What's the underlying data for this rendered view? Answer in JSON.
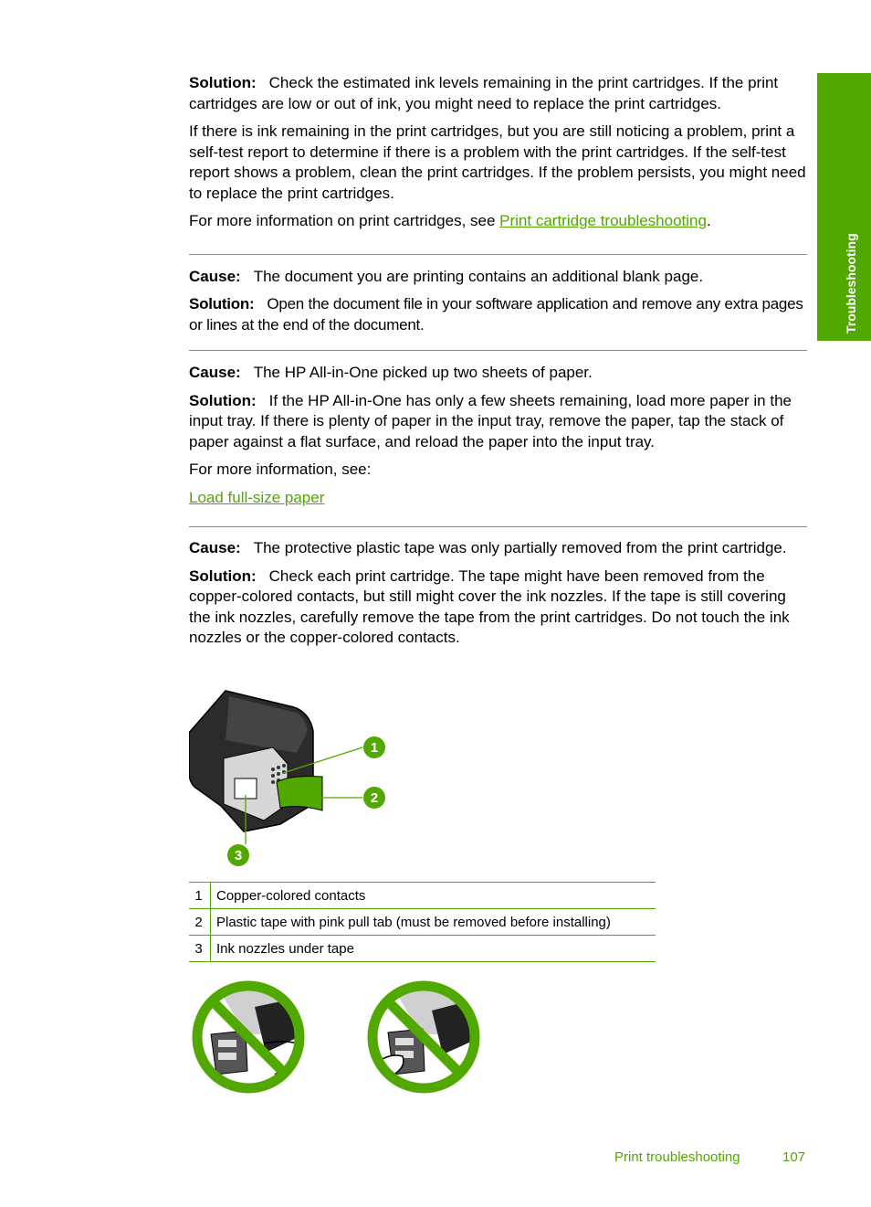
{
  "side_tab": {
    "label": "Troubleshooting"
  },
  "sections": [
    {
      "solution_label": "Solution:",
      "solution_text": "Check the estimated ink levels remaining in the print cartridges. If the print cartridges are low or out of ink, you might need to replace the print cartridges.",
      "paragraph": "If there is ink remaining in the print cartridges, but you are still noticing a problem, print a self-test report to determine if there is a problem with the print cartridges. If the self-test report shows a problem, clean the print cartridges. If the problem persists, you might need to replace the print cartridges.",
      "more_info_prefix": "For more information on print cartridges, see ",
      "more_info_link": "Print cartridge troubleshooting",
      "more_info_suffix": "."
    },
    {
      "cause_label": "Cause:",
      "cause_text": "The document you are printing contains an additional blank page.",
      "solution_label": "Solution:",
      "solution_text": "Open the document file in your software application and remove any extra pages or lines at the end of the document."
    },
    {
      "cause_label": "Cause:",
      "cause_text": "The HP All-in-One picked up two sheets of paper.",
      "solution_label": "Solution:",
      "solution_text": "If the HP All-in-One has only a few sheets remaining, load more paper in the input tray. If there is plenty of paper in the input tray, remove the paper, tap the stack of paper against a flat surface, and reload the paper into the input tray.",
      "more_info": "For more information, see:",
      "link": "Load full-size paper"
    },
    {
      "cause_label": "Cause:",
      "cause_text": "The protective plastic tape was only partially removed from the print cartridge.",
      "solution_label": "Solution:",
      "solution_text": "Check each print cartridge. The tape might have been removed from the copper-colored contacts, but still might cover the ink nozzles. If the tape is still covering the ink nozzles, carefully remove the tape from the print cartridges. Do not touch the ink nozzles or the copper-colored contacts."
    }
  ],
  "figure": {
    "callouts": [
      "1",
      "2",
      "3"
    ],
    "legend": [
      {
        "num": "1",
        "text": "Copper-colored contacts"
      },
      {
        "num": "2",
        "text": "Plastic tape with pink pull tab (must be removed before installing)"
      },
      {
        "num": "3",
        "text": "Ink nozzles under tape"
      }
    ]
  },
  "footer": {
    "section": "Print troubleshooting",
    "page": "107"
  },
  "colors": {
    "accent": "#51a800",
    "rule": "#8a8a8a"
  }
}
